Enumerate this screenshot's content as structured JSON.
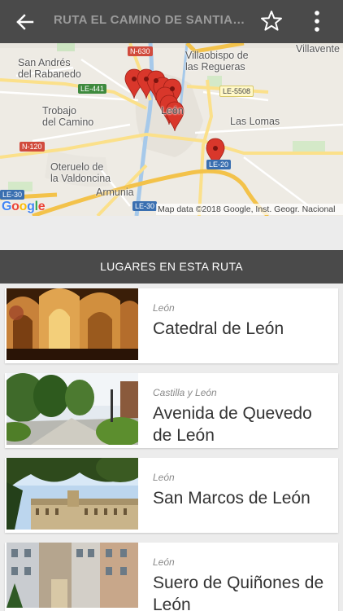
{
  "appbar": {
    "title": "RUTA EL CAMINO DE SANTIAGO...",
    "back_icon": "arrow-left-icon",
    "favorite_icon": "star-outline-icon",
    "menu_icon": "more-vertical-icon"
  },
  "map": {
    "labels": {
      "san_andres": "San Andrés\ndel Rabanedo",
      "villaobispo": "Villaobispo de\nlas Regueras",
      "villavente": "Villavente",
      "trobajo": "Trobajo\ndel Camino",
      "lomas": "Las Lomas",
      "oteruelo": "Oteruelo de\nla Valdoncina",
      "armunia": "Armunia",
      "leon": "León"
    },
    "roads": {
      "n630": "N-630",
      "le441": "LE-441",
      "le5508": "LE-5508",
      "n120": "N-120",
      "le30a": "LE-30",
      "le30b": "LE-30",
      "le20": "LE-20"
    },
    "logo": "Google",
    "attribution": "Map data ©2018 Google, Inst. Geogr. Nacional",
    "marker_icon": "map-pin-icon"
  },
  "section": {
    "title": "LUGARES EN ESTA RUTA"
  },
  "places": [
    {
      "region": "León",
      "name": "Catedral de León"
    },
    {
      "region": "Castilla y León",
      "name": "Avenida de Quevedo de León"
    },
    {
      "region": "León",
      "name": "San Marcos de León"
    },
    {
      "region": "León",
      "name": "Suero de Quiñones de León"
    }
  ],
  "colors": {
    "appbar": "#4a4a4a",
    "marker": "#d9372b",
    "background": "#ececec"
  }
}
